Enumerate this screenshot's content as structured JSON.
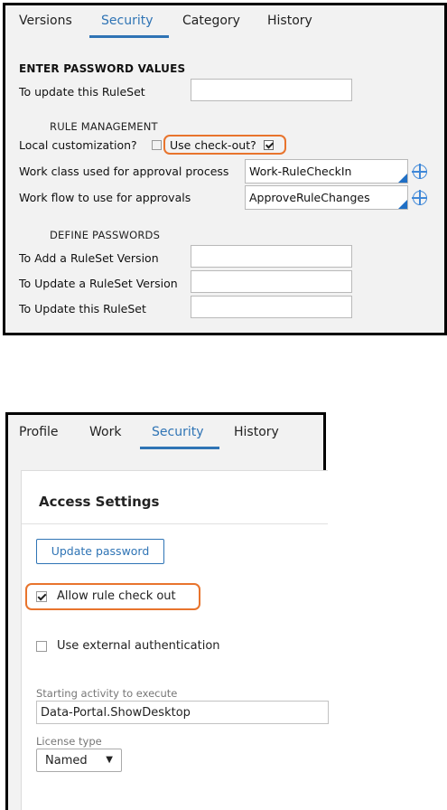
{
  "ruleset_form": {
    "tabs": [
      {
        "label": "Versions",
        "active": false
      },
      {
        "label": "Security",
        "active": true
      },
      {
        "label": "Category",
        "active": false
      },
      {
        "label": "History",
        "active": false
      }
    ],
    "enter_password_heading": "ENTER PASSWORD VALUES",
    "update_ruleset_label": "To update this RuleSet",
    "update_ruleset_value": "",
    "rule_management_heading": "RULE MANAGEMENT",
    "local_customization_label": "Local customization?",
    "local_customization_checked": false,
    "use_checkout_label": "Use check-out?",
    "use_checkout_checked": true,
    "work_class_label": "Work class used for approval process",
    "work_class_value": "Work-RuleCheckIn",
    "work_flow_label": "Work flow to use for approvals",
    "work_flow_value": "ApproveRuleChanges",
    "define_passwords_heading": "DEFINE PASSWORDS",
    "add_version_label": "To Add a RuleSet Version",
    "update_version_label": "To Update a RuleSet Version",
    "update_this_label": "To Update this RuleSet"
  },
  "operator_form": {
    "tabs": [
      {
        "label": "Profile",
        "active": false
      },
      {
        "label": "Work",
        "active": false
      },
      {
        "label": "Security",
        "active": true
      },
      {
        "label": "History",
        "active": false
      }
    ],
    "section_title": "Access Settings",
    "update_password_button": "Update password",
    "allow_checkout_label": "Allow rule check out",
    "allow_checkout_checked": true,
    "external_auth_label": "Use external authentication",
    "external_auth_checked": false,
    "starting_activity_label": "Starting activity to execute",
    "starting_activity_value": "Data-Portal.ShowDesktop",
    "license_type_label": "License type",
    "license_type_value": "Named"
  },
  "colors": {
    "accent_blue": "#2f74b5",
    "highlight_orange": "#e8742d",
    "panel_bg": "#f2f2f2"
  }
}
